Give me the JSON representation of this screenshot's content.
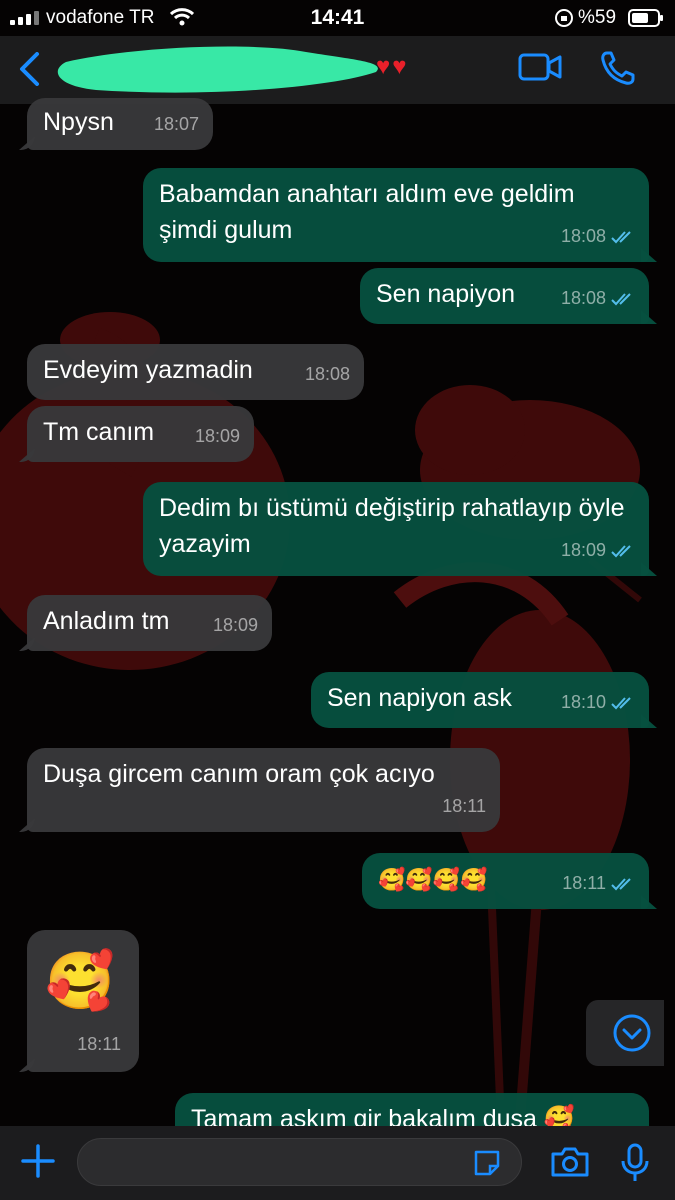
{
  "status_bar": {
    "carrier": "vodafone TR",
    "time": "14:41",
    "battery_percent": "%59"
  },
  "header": {
    "hearts": "♥♥",
    "icons": [
      "back-chevron-icon",
      "video-call-icon",
      "phone-call-icon"
    ]
  },
  "messages": [
    {
      "dir": "in",
      "text": "Npysn",
      "time": "18:07"
    },
    {
      "dir": "out",
      "text": "Babamdan anahtarı aldım eve geldim şimdi gulum",
      "time": "18:08",
      "read": true
    },
    {
      "dir": "out",
      "text": "Sen napiyon",
      "time": "18:08",
      "read": true
    },
    {
      "dir": "in",
      "text": "Evdeyim yazmadin",
      "time": "18:08"
    },
    {
      "dir": "in",
      "text": "Tm canım",
      "time": "18:09"
    },
    {
      "dir": "out",
      "text": "Dedim bı üstümü değiştirip rahatlayıp öyle yazayim",
      "time": "18:09",
      "read": true
    },
    {
      "dir": "in",
      "text": "Anladım tm",
      "time": "18:09"
    },
    {
      "dir": "out",
      "text": "Sen napiyon ask",
      "time": "18:10",
      "read": true
    },
    {
      "dir": "in",
      "text": "Duşa gircem canım oram çok acıyo",
      "time": "18:11"
    },
    {
      "dir": "out",
      "text": "🥰🥰🥰🥰",
      "time": "18:11",
      "read": true
    },
    {
      "dir": "in",
      "text": "🥰",
      "time": "18:11"
    },
    {
      "dir": "out",
      "text": "Tamam askım gir bakalım dusa 🥰",
      "time": ""
    }
  ],
  "input_bar": {
    "placeholder": "",
    "icons": [
      "plus-icon",
      "sticker-icon",
      "camera-icon",
      "microphone-icon"
    ]
  },
  "colors": {
    "accent": "#1a8cff",
    "incoming_bubble": "#38383a",
    "outgoing_bubble": "#065040",
    "read_ticks": "#53bdeb"
  }
}
